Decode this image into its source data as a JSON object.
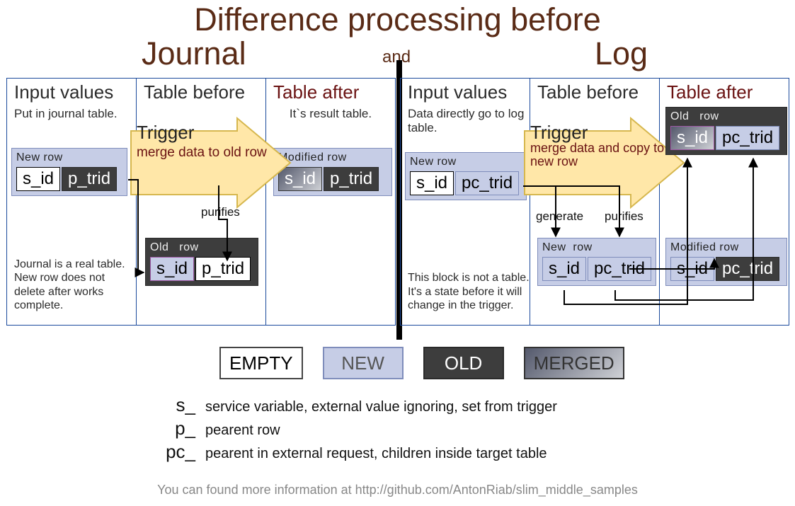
{
  "titles": {
    "main": "Difference processing before",
    "left": "Journal",
    "right": "Log",
    "and": "and"
  },
  "panels": {
    "j_input": {
      "title": "Input values",
      "sub": "Put in journal table.",
      "note": "Journal is a real table. New row does not delete after works complete."
    },
    "j_before": {
      "title": "Table before"
    },
    "j_after": {
      "title": "Table after",
      "sub": "It`s result table."
    },
    "l_input": {
      "title": "Input values",
      "sub": "Data directly go to log table.",
      "note": "This block is not a table. It's a state before it will change in the trigger."
    },
    "l_before": {
      "title": "Table before"
    },
    "l_after": {
      "title": "Table after"
    }
  },
  "triggers": {
    "journal": {
      "title": "Trigger",
      "sub": "merge data to old row"
    },
    "log": {
      "title": "Trigger",
      "sub": "merge data and copy to new row"
    }
  },
  "labels": {
    "purifies": "purifies",
    "generate": "generate"
  },
  "rows": {
    "new": "New row",
    "old": "Old row",
    "modified": "Modified row",
    "new2": "New  row",
    "old2": "Old   row"
  },
  "cols": {
    "sid": "s_id",
    "ptr": "p_trid",
    "pctr": "pc_trid"
  },
  "legend": {
    "empty": "EMPTY",
    "new": "NEW",
    "old": "OLD",
    "merged": "MERGED"
  },
  "prefixes": {
    "s": {
      "key": "s_",
      "desc": "service variable, external value ignoring, set from trigger"
    },
    "p": {
      "key": "p_",
      "desc": "pearent row"
    },
    "pc": {
      "key": "pc_",
      "desc": "pearent in external request, children inside target table"
    }
  },
  "footer": "You can found more information at http://github.com/AntonRiab/slim_middle_samples"
}
